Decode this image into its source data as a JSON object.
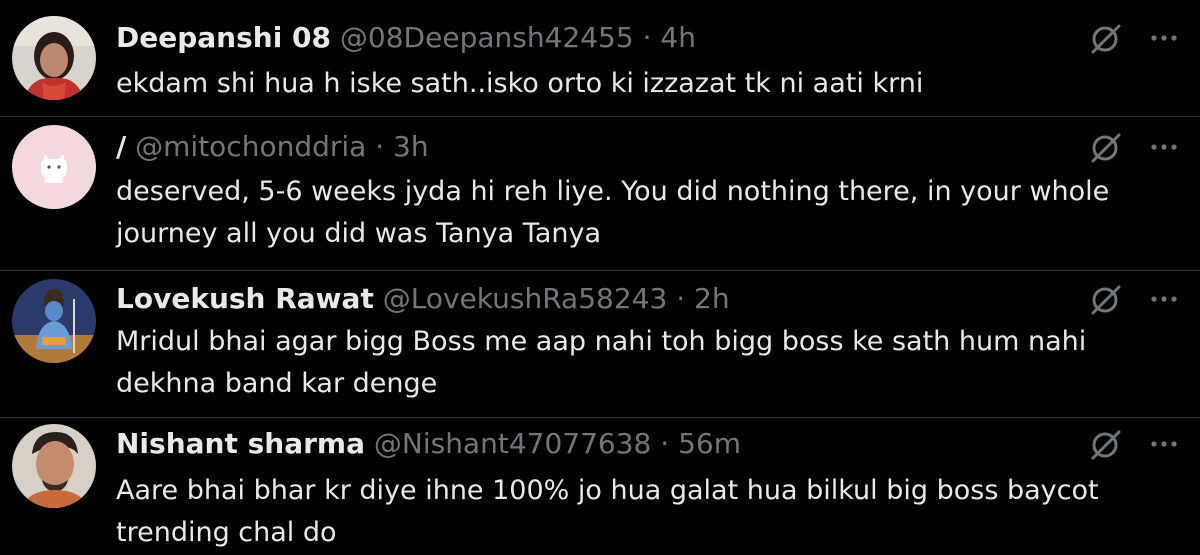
{
  "replies": [
    {
      "name": "Deepanshi 08",
      "handle": "@08Deepansh42455",
      "separator": "·",
      "time": "4h",
      "text": "ekdam shi hua h iske sath..isko orto ki izzazat tk ni aati krni"
    },
    {
      "name": "/",
      "handle": "@mitochonddria",
      "separator": "·",
      "time": "3h",
      "text_lines": [
        "deserved, 5-6 weeks jyda hi reh liye. You did nothing there, in your whole",
        "journey all you did was Tanya Tanya"
      ]
    },
    {
      "name": "Lovekush Rawat",
      "handle": "@LovekushRa58243",
      "separator": "·",
      "time": "2h",
      "text_lines": [
        "Mridul bhai agar bigg Boss me aap nahi toh bigg boss ke sath hum nahi",
        "dekhna band kar denge"
      ]
    },
    {
      "name": "Nishant sharma",
      "handle": "@Nishant47077638",
      "separator": "·",
      "time": "56m",
      "text_lines": [
        "Aare bhai bhar kr diye ihne 100% jo hua galat hua bilkul big boss baycot",
        "trending chal do"
      ]
    }
  ],
  "icons": {
    "grok": "grok-icon",
    "more": "more-icon"
  },
  "colors": {
    "background": "#000000",
    "primary_text": "#e7e9ea",
    "secondary_text": "#71767b",
    "divider": "#2f3336"
  }
}
